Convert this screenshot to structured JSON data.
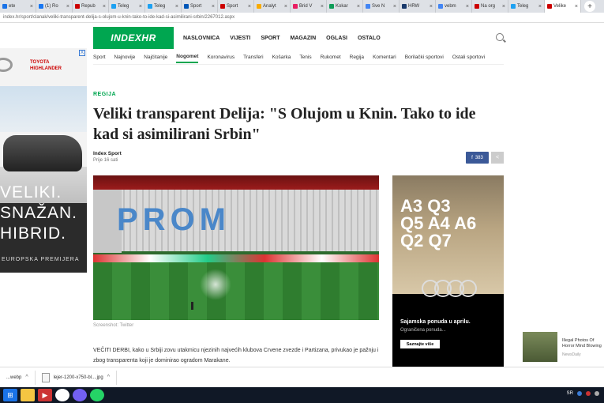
{
  "browser": {
    "tabs": [
      {
        "label": "ete",
        "color": "#1a73e8"
      },
      {
        "label": "(1) Ro",
        "color": "#1877f2"
      },
      {
        "label": "Repub",
        "color": "#c00"
      },
      {
        "label": "Teleg",
        "color": "#1da1f2"
      },
      {
        "label": "Teleg",
        "color": "#1da1f2"
      },
      {
        "label": "Sport",
        "color": "#0057b8"
      },
      {
        "label": "Sport",
        "color": "#c00"
      },
      {
        "label": "Analyt",
        "color": "#f9ab00"
      },
      {
        "label": "Brid V",
        "color": "#e91e63"
      },
      {
        "label": "Kokar",
        "color": "#0f9d58"
      },
      {
        "label": "Sve N",
        "color": "#4285f4"
      },
      {
        "label": "HRW",
        "color": "#1a3a6b"
      },
      {
        "label": "vebm",
        "color": "#4285f4"
      },
      {
        "label": "Na org",
        "color": "#c00"
      },
      {
        "label": "Teleg",
        "color": "#1da1f2"
      },
      {
        "label": "Velike",
        "color": "#c00"
      }
    ],
    "new_tab": "+",
    "address": "index.hr/sport/clanak/veliki-transparent-delija-s-olujom-u-knin-tako-to-ide-kad-si-asimilirani-srbin/2267012.aspx"
  },
  "ad_left": {
    "brand": "TOYOTA",
    "model": "HIGHLANDER",
    "headline_lines": [
      "VELIKI.",
      "SNAŽAN.",
      "HIBRID."
    ],
    "sub": "EUROPSKA PREMIJERA",
    "close": "X"
  },
  "site": {
    "logo": "INDEXHR",
    "menu": [
      "NASLOVNICA",
      "VIJESTI",
      "SPORT",
      "MAGAZIN",
      "OGLASI",
      "OSTALO"
    ],
    "subnav": [
      "Sport",
      "Najnovije",
      "Najčitanije",
      "Nogomet",
      "Koronavirus",
      "Transferi",
      "Košarka",
      "Tenis",
      "Rukomet",
      "Regija",
      "Komentari",
      "Borilački sportovi",
      "Ostali sportovi"
    ],
    "subnav_active": "Nogomet"
  },
  "article": {
    "category": "REGIJA",
    "title": "Veliki transparent Delija: \"S Olujom u Knin. Tako to ide kad si asimilirani Srbin\"",
    "author": "Index Sport",
    "time": "Prije 16 sati",
    "share_count": "383",
    "photo_text": "PROM",
    "caption": "Screenshot: Twitter",
    "body": "VEČITI DERBI, kako u Srbiji zovu utakmicu njezinih najvećih klubova Crvene zvezde i Partizana, privukao je pažnju i zbog transparenta koji je dominirao ogradom Marakane."
  },
  "ad_right": {
    "models": [
      "A3 Q3",
      "Q5 A4 A6",
      "Q2 Q7"
    ],
    "headline": "Sajamska ponuda u aprilu.",
    "sub": "Ograničena ponuda...",
    "button": "Saznajte više"
  },
  "promo": {
    "title": "Illegal Photos Of Horror Mind Blowing",
    "source": "NewsDaily"
  },
  "downloads": [
    {
      "name": "...webp"
    },
    {
      "name": "lejer-1200-x750-bl....jpg"
    }
  ],
  "taskbar": {
    "lang": "SR",
    "colors": {
      "accent": "#00a650",
      "fb": "#3b5998"
    }
  }
}
